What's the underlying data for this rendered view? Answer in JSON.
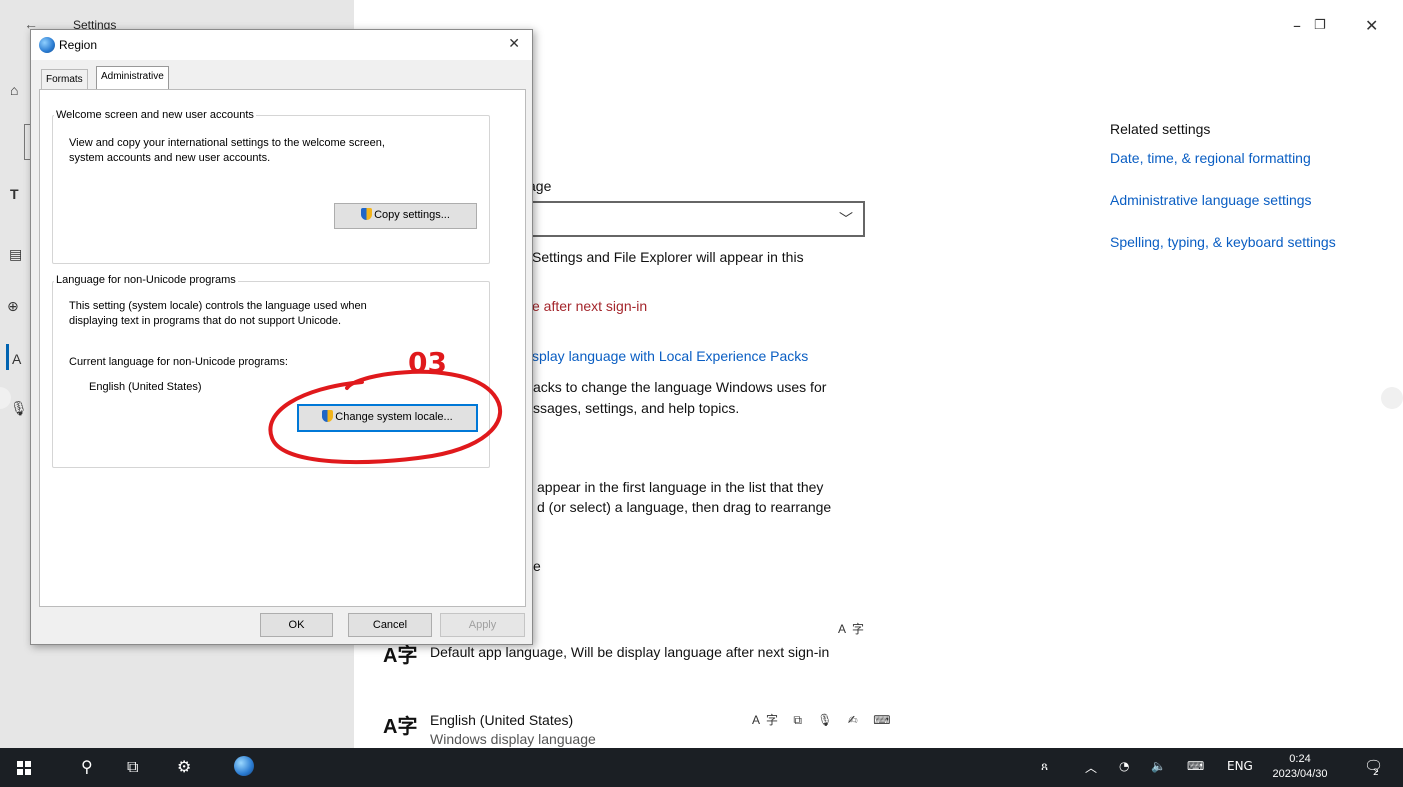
{
  "settings": {
    "title": "Settings",
    "related": {
      "title": "Related settings",
      "links": [
        "Date, time, & regional formatting",
        "Administrative language settings",
        "Spelling, typing, & keyboard settings"
      ]
    },
    "visible_fragments": {
      "display_lang_label": "age",
      "display_desc": "Settings and File Explorer will appear in this",
      "warning": "e after next sign-in",
      "local_exp_link": "splay language with Local Experience Packs",
      "packs_line1": "acks to change the language Windows uses for",
      "packs_line2": "ssages, settings, and help topics.",
      "pref_line1": "appear in the first language in the list that they",
      "pref_line2": "d (or select) a language, then drag to rearrange",
      "pref_line3": "e"
    },
    "default_app_lang": "Default app language, Will be display language after next sign-in",
    "language_item": {
      "name": "English (United States)",
      "sub": "Windows display language"
    }
  },
  "dialog": {
    "title": "Region",
    "tabs": [
      "Formats",
      "Administrative"
    ],
    "active_tab": "Administrative",
    "welcome_group": {
      "label": "Welcome screen and new user accounts",
      "desc_line1": "View and copy your international settings to the welcome screen,",
      "desc_line2": "system accounts and new user accounts.",
      "button": "Copy settings..."
    },
    "nonunicode_group": {
      "label": "Language for non-Unicode programs",
      "desc_line1": "This setting (system locale) controls the language used when",
      "desc_line2": "displaying text in programs that do not support Unicode.",
      "current_label": "Current language for non-Unicode programs:",
      "current_value": "English (United States)",
      "button": "Change system locale..."
    },
    "buttons": {
      "ok": "OK",
      "cancel": "Cancel",
      "apply": "Apply"
    }
  },
  "annotation": {
    "label": "03",
    "color": "#e0191c"
  },
  "taskbar": {
    "tray_lang": "ENG",
    "time": "0:24",
    "date": "2023/04/30",
    "notification_count": "2"
  }
}
